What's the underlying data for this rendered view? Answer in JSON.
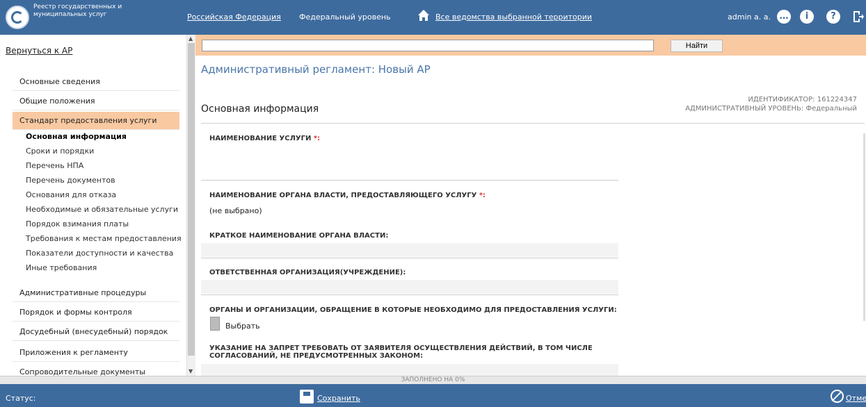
{
  "header": {
    "logo_text": "Реестр государственных и муниципальных услуг",
    "link_federation": "Российская Федерация",
    "level": "Федеральный уровень",
    "link_departments": "Все ведомства выбранной территории",
    "user": "admin a. a."
  },
  "sidebar": {
    "back": "Вернуться к АР",
    "groups": [
      "Основные сведения",
      "Общие положения",
      "Стандарт предоставления услуги"
    ],
    "subs": [
      "Основная информация",
      "Сроки и порядки",
      "Перечень НПА",
      "Перечень документов",
      "Основания для отказа",
      "Необходимые и обязательные услуги",
      "Порядок взимания платы",
      "Требования к местам предоставления",
      "Показатели доступности и качества",
      "Иные требования"
    ],
    "groups2": [
      "Административные процедуры",
      "Порядок и формы контроля",
      "Досудебный (внесудебный) порядок",
      "Приложения к регламенту",
      "Сопроводительные документы"
    ]
  },
  "search": {
    "button": "Найти",
    "value": ""
  },
  "main": {
    "title": "Административный регламент: Новый АР",
    "section": "Основная информация",
    "ident_label": "ИДЕНТИФИКАТОР: 161224347",
    "admin_level": "АДМИНИСТРАТИВНЫЙ УРОВЕНЬ: Федеральный",
    "fields": [
      "НАИМЕНОВАНИЕ УСЛУГИ",
      "НАИМЕНОВАНИЕ ОРГАНА ВЛАСТИ, ПРЕДОСТАВЛЯЮЩЕГО УСЛУГУ",
      "КРАТКОЕ НАИМЕНОВАНИЕ ОРГАНА ВЛАСТИ:",
      "ОТВЕТСТВЕННАЯ ОРГАНИЗАЦИЯ(УЧРЕЖДЕНИЕ):",
      "ОРГАНЫ И ОРГАНИЗАЦИИ, ОБРАЩЕНИЕ В КОТОРЫЕ НЕОБХОДИМО ДЛЯ ПРЕДОСТАВЛЕНИЯ УСЛУГИ:",
      "УКАЗАНИЕ НА ЗАПРЕТ ТРЕБОВАТЬ ОТ ЗАЯВИТЕЛЯ ОСУЩЕСТВЛЕНИЯ ДЕЙСТВИЙ, В ТОМ ЧИСЛЕ",
      "СОГЛАСОВАНИЙ, НЕ ПРЕДУСМОТРЕННЫХ ЗАКОНОМ:"
    ],
    "not_selected": "(не выбрано)",
    "select_label": "Выбрать",
    "required_mark": "*:"
  },
  "progress": {
    "label": "ЗАПОЛНЕНО НА 0%",
    "percent": 0
  },
  "footer": {
    "status": "Статус:",
    "save": "Сохранить",
    "cancel": "Отменить"
  },
  "colors": {
    "brand": "#3e6b9e",
    "accent": "#f9c9a1"
  }
}
